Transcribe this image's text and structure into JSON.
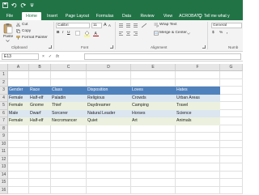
{
  "quick_access": {
    "icons": [
      "save-icon",
      "undo-icon",
      "redo-icon",
      "customize-icon"
    ]
  },
  "tabs": [
    {
      "label": "File"
    },
    {
      "label": "Home"
    },
    {
      "label": "Insert"
    },
    {
      "label": "Page Layout"
    },
    {
      "label": "Formulas"
    },
    {
      "label": "Data"
    },
    {
      "label": "Review"
    },
    {
      "label": "View"
    },
    {
      "label": "ACROBAT"
    }
  ],
  "tell_me": "Tell me what y",
  "ribbon": {
    "clipboard": {
      "paste": "Paste",
      "cut": "Cut",
      "copy": "Copy",
      "format_painter": "Format Painter",
      "label": "Clipboard"
    },
    "font": {
      "name": "Calibri",
      "size": "11",
      "label": "Font",
      "bold": "B",
      "italic": "I",
      "underline": "U",
      "grow": "A",
      "shrink": "A"
    },
    "alignment": {
      "wrap_text": "Wrap Text",
      "merge_center": "Merge & Center",
      "label": "Alignment"
    },
    "number": {
      "format": "General",
      "label": "Numb",
      "currency": "$",
      "percent": "%",
      "comma": ","
    }
  },
  "formula_bar": {
    "name_box": "E13",
    "fx": "fx",
    "cancel": "×",
    "enter": "✓"
  },
  "columns": [
    "A",
    "B",
    "C",
    "D",
    "E",
    "F",
    "G"
  ],
  "rows": [
    "1",
    "2",
    "3",
    "4",
    "5",
    "6",
    "7",
    "8",
    "9",
    "10",
    "11",
    "12",
    "13",
    "14",
    "15",
    "16"
  ],
  "table": {
    "headers": [
      "Gender",
      "Race",
      "Class",
      "Disposition",
      "Loves",
      "Hates"
    ],
    "rows": [
      [
        "Female",
        "Half-elf",
        "Paladin",
        "Religious",
        "Crowds",
        "Urban Areas"
      ],
      [
        "Female",
        "Gnome",
        "Thief",
        "Daydreamer",
        "Camping",
        "Travel"
      ],
      [
        "Male",
        "Dwarf",
        "Sorcerer",
        "Natural Leader",
        "Horses",
        "Science"
      ],
      [
        "Female",
        "Half-elf",
        "Necromancer",
        "Quiet",
        "Art",
        "Animals"
      ]
    ]
  },
  "colors": {
    "brand_green": "#217346",
    "header_blue": "#4f81bd",
    "band_blue": "#dce6f1",
    "band_green": "#ebf1de"
  }
}
